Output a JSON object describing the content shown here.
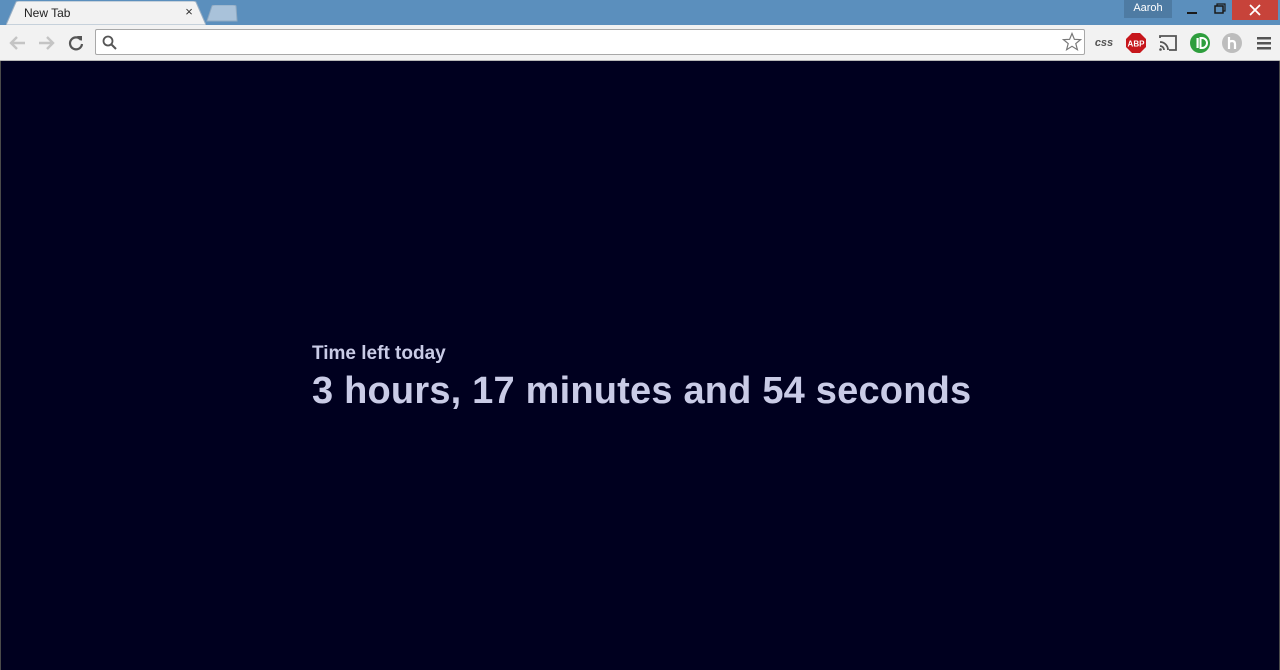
{
  "browser": {
    "tab_title": "New Tab",
    "tab_close": "×",
    "profile_name": "Aaroh",
    "omnibox": {
      "value": "",
      "placeholder": ""
    },
    "extensions": {
      "css_label": "css",
      "abp_label": "ABP"
    },
    "icons": [
      "back-icon",
      "forward-icon",
      "reload-icon",
      "search-icon",
      "star-icon",
      "cast-icon",
      "menu-icon"
    ]
  },
  "page": {
    "label": "Time left today",
    "countdown": "3 hours, 17 minutes and 54 seconds",
    "background_color": "#00001f",
    "text_color": "#c9cbe6"
  }
}
